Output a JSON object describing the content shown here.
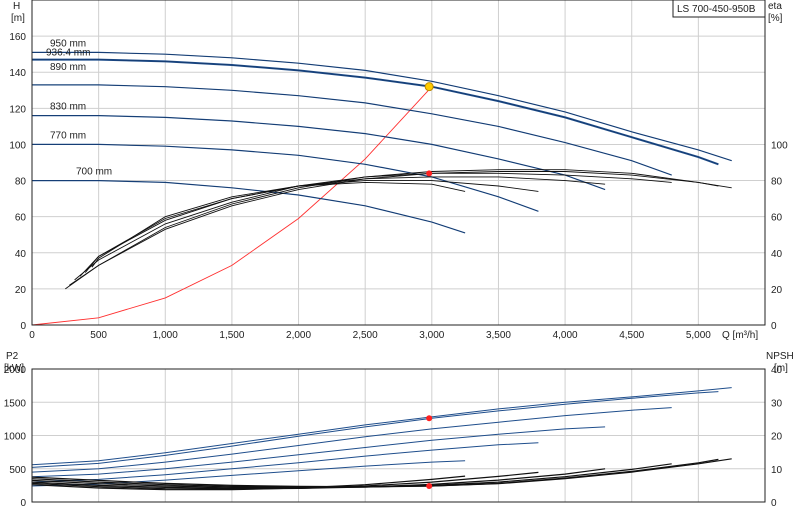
{
  "model": "LS 700-450-950B",
  "chart_data": [
    {
      "type": "line",
      "title": "",
      "xlabel": "Q [m³/h]",
      "ylabel": "H\n[m]",
      "y2label": "eta\n[%]",
      "xlim": [
        0,
        5500
      ],
      "ylim": [
        0,
        180
      ],
      "y2lim": [
        0,
        180
      ],
      "xticks": [
        0,
        500,
        1000,
        1500,
        2000,
        2500,
        3000,
        3500,
        4000,
        4500,
        5000
      ],
      "xtick_labels": [
        "0",
        "500",
        "1,000",
        "1,500",
        "2,000",
        "2,500",
        "3,000",
        "3,500",
        "4,000",
        "4,500",
        "5,000"
      ],
      "yticks": [
        0,
        20,
        40,
        60,
        80,
        100,
        120,
        140,
        160
      ],
      "y2ticks": [
        0,
        20,
        40,
        60,
        80,
        100
      ],
      "grid": true,
      "head_curves": [
        {
          "name": "950 mm",
          "x": [
            0,
            500,
            1000,
            1500,
            2000,
            2500,
            3000,
            3500,
            4000,
            4500,
            5000,
            5250
          ],
          "y": [
            151,
            151,
            150,
            148,
            145,
            141,
            135,
            127,
            118,
            107,
            97,
            91
          ]
        },
        {
          "name": "936.4 mm",
          "x": [
            0,
            500,
            1000,
            1500,
            2000,
            2500,
            3000,
            3500,
            4000,
            4500,
            5000,
            5150
          ],
          "y": [
            147,
            147,
            146,
            144,
            141,
            137,
            132,
            124,
            115,
            104,
            93,
            89
          ]
        },
        {
          "name": "890 mm",
          "x": [
            0,
            500,
            1000,
            1500,
            2000,
            2500,
            3000,
            3500,
            4000,
            4500,
            4800
          ],
          "y": [
            133,
            133,
            132,
            130,
            127,
            123,
            117,
            110,
            101,
            91,
            83
          ]
        },
        {
          "name": "830 mm",
          "x": [
            0,
            500,
            1000,
            1500,
            2000,
            2500,
            3000,
            3500,
            4000,
            4300
          ],
          "y": [
            116,
            116,
            115,
            113,
            110,
            106,
            100,
            92,
            83,
            75
          ]
        },
        {
          "name": "770 mm",
          "x": [
            0,
            500,
            1000,
            1500,
            2000,
            2500,
            3000,
            3500,
            3800
          ],
          "y": [
            100,
            100,
            99,
            97,
            94,
            89,
            82,
            71,
            63
          ]
        },
        {
          "name": "700 mm",
          "x": [
            0,
            500,
            1000,
            1500,
            2000,
            2500,
            3000,
            3250
          ],
          "y": [
            80,
            80,
            79,
            76,
            72,
            66,
            57,
            51
          ]
        }
      ],
      "system_curve": {
        "x": [
          0,
          500,
          1000,
          1500,
          2000,
          2500,
          3000
        ],
        "y": [
          0,
          4,
          15,
          33,
          59,
          92,
          132
        ]
      },
      "eta_curves": [
        {
          "x": [
            250,
            500,
            1000,
            1500,
            2000,
            2500,
            3000,
            3500,
            4000,
            4500,
            5000,
            5250
          ],
          "y": [
            20,
            33,
            54,
            67,
            76,
            82,
            85,
            86,
            86,
            84,
            79,
            76
          ]
        },
        {
          "x": [
            280,
            500,
            1000,
            1500,
            2000,
            2500,
            3000,
            3500,
            4000,
            4500,
            5000,
            5150
          ],
          "y": [
            22,
            33,
            53,
            66,
            75,
            81,
            84,
            85,
            85,
            83,
            79,
            77
          ]
        },
        {
          "x": [
            320,
            500,
            1000,
            1500,
            2000,
            2500,
            3000,
            3500,
            4000,
            4500,
            4800
          ],
          "y": [
            25,
            36,
            56,
            68,
            77,
            82,
            84,
            84,
            83,
            81,
            79
          ]
        },
        {
          "x": [
            360,
            500,
            1000,
            1500,
            2000,
            2500,
            3000,
            3500,
            4000,
            4300
          ],
          "y": [
            27,
            38,
            58,
            70,
            77,
            81,
            82,
            82,
            80,
            78
          ]
        },
        {
          "x": [
            400,
            500,
            1000,
            1500,
            2000,
            2500,
            3000,
            3500,
            3800
          ],
          "y": [
            29,
            38,
            59,
            70,
            77,
            80,
            80,
            77,
            74
          ]
        },
        {
          "x": [
            450,
            500,
            1000,
            1500,
            2000,
            2500,
            3000,
            3250
          ],
          "y": [
            32,
            37,
            60,
            71,
            77,
            79,
            78,
            74
          ]
        }
      ],
      "duty_point": {
        "x": 2980,
        "y": 132
      },
      "eta_point": {
        "x": 2980,
        "y": 84
      }
    },
    {
      "type": "line",
      "title": "",
      "ylabel": "P2\n[kW]",
      "y2label": "NPSH\n[m]",
      "xlim": [
        0,
        5500
      ],
      "ylim": [
        0,
        2000
      ],
      "y2lim": [
        0,
        40
      ],
      "yticks": [
        0,
        500,
        1000,
        1500,
        2000
      ],
      "y2ticks": [
        0,
        10,
        20,
        30,
        40
      ],
      "grid": true,
      "power_curves": [
        {
          "x": [
            0,
            500,
            1000,
            1500,
            2000,
            2500,
            3000,
            3500,
            4000,
            4500,
            5000,
            5250
          ],
          "y": [
            560,
            620,
            740,
            880,
            1020,
            1160,
            1280,
            1400,
            1500,
            1580,
            1670,
            1720
          ]
        },
        {
          "x": [
            0,
            500,
            1000,
            1500,
            2000,
            2500,
            3000,
            3500,
            4000,
            4500,
            5000,
            5150
          ],
          "y": [
            520,
            580,
            700,
            840,
            990,
            1130,
            1260,
            1370,
            1470,
            1560,
            1640,
            1660
          ]
        },
        {
          "x": [
            0,
            500,
            1000,
            1500,
            2000,
            2500,
            3000,
            3500,
            4000,
            4500,
            4800
          ],
          "y": [
            450,
            500,
            600,
            720,
            850,
            980,
            1100,
            1200,
            1300,
            1380,
            1420
          ]
        },
        {
          "x": [
            0,
            500,
            1000,
            1500,
            2000,
            2500,
            3000,
            3500,
            4000,
            4300
          ],
          "y": [
            380,
            420,
            500,
            600,
            710,
            820,
            930,
            1020,
            1100,
            1130
          ]
        },
        {
          "x": [
            0,
            500,
            1000,
            1500,
            2000,
            2500,
            3000,
            3500,
            3800
          ],
          "y": [
            300,
            340,
            410,
            500,
            590,
            690,
            780,
            860,
            890
          ]
        },
        {
          "x": [
            0,
            500,
            1000,
            1500,
            2000,
            2500,
            3000,
            3250
          ],
          "y": [
            240,
            270,
            330,
            400,
            470,
            540,
            600,
            620
          ]
        }
      ],
      "npsh_curves": [
        {
          "x": [
            0,
            500,
            1000,
            1500,
            2000,
            2500,
            3000,
            3500,
            4000,
            4500,
            5000,
            5250
          ],
          "y": [
            7.5,
            6.5,
            5.6,
            5.0,
            4.7,
            4.6,
            4.8,
            5.5,
            7.0,
            9.0,
            11.5,
            13.0
          ]
        },
        {
          "x": [
            0,
            500,
            1000,
            1500,
            2000,
            2500,
            3000,
            3500,
            4000,
            4500,
            5000,
            5150
          ],
          "y": [
            7.0,
            6.0,
            5.2,
            4.7,
            4.5,
            4.5,
            4.8,
            5.6,
            7.2,
            9.2,
            11.8,
            12.8
          ]
        },
        {
          "x": [
            0,
            500,
            1000,
            1500,
            2000,
            2500,
            3000,
            3500,
            4000,
            4500,
            4800
          ],
          "y": [
            6.5,
            5.5,
            4.8,
            4.4,
            4.3,
            4.5,
            5.0,
            6.0,
            7.6,
            9.8,
            11.5
          ]
        },
        {
          "x": [
            0,
            500,
            1000,
            1500,
            2000,
            2500,
            3000,
            3500,
            4000,
            4300
          ],
          "y": [
            6.0,
            5.0,
            4.4,
            4.1,
            4.1,
            4.5,
            5.3,
            6.6,
            8.4,
            10.0
          ]
        },
        {
          "x": [
            0,
            500,
            1000,
            1500,
            2000,
            2500,
            3000,
            3500,
            3800
          ],
          "y": [
            5.6,
            4.6,
            4.0,
            3.9,
            4.1,
            4.8,
            6.0,
            7.7,
            8.9
          ]
        },
        {
          "x": [
            0,
            500,
            1000,
            1500,
            2000,
            2500,
            3000,
            3250
          ],
          "y": [
            5.2,
            4.2,
            3.7,
            3.7,
            4.2,
            5.2,
            6.8,
            7.8
          ]
        }
      ],
      "power_point": {
        "x": 2980,
        "y": 1260
      },
      "npsh_point": {
        "x": 2980,
        "y": 4.8
      }
    }
  ]
}
